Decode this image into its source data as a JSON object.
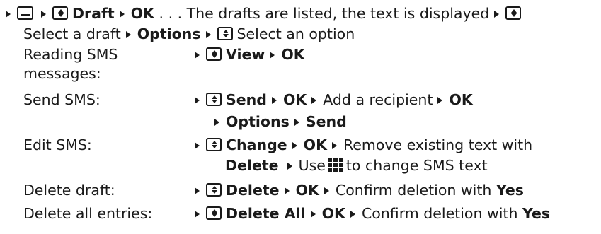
{
  "intro": {
    "draft": "Draft",
    "ok": "OK",
    "listed": ". . . The drafts are listed, the text is displayed",
    "select_draft": "Select a draft",
    "options": "Options",
    "select_option": "Select an option"
  },
  "rows": [
    {
      "label": "Reading SMS messages:",
      "line1": {
        "key": "View",
        "ok": "OK"
      }
    },
    {
      "label": "Send SMS:",
      "line1": {
        "key": "Send",
        "ok": "OK",
        "text": "Add a recipient",
        "ok2": "OK"
      },
      "line2": {
        "a": "Options",
        "b": "Send"
      }
    },
    {
      "label": "Edit SMS:",
      "line1": {
        "key": "Change",
        "ok": "OK",
        "text": "Remove existing text with"
      },
      "line2": {
        "key": "Delete",
        "text1": "Use",
        "text2": "to change SMS text"
      }
    },
    {
      "label": "Delete draft:",
      "line1": {
        "key": "Delete",
        "ok": "OK",
        "text": "Confirm deletion with",
        "yes": "Yes"
      }
    },
    {
      "label": "Delete all entries:",
      "line1": {
        "key": "Delete All",
        "ok": "OK",
        "text": "Confirm deletion with",
        "yes": "Yes"
      }
    }
  ],
  "icons": [
    "bullet-arrow-icon",
    "message-key-icon",
    "nav-key-icon",
    "keypad-icon"
  ]
}
